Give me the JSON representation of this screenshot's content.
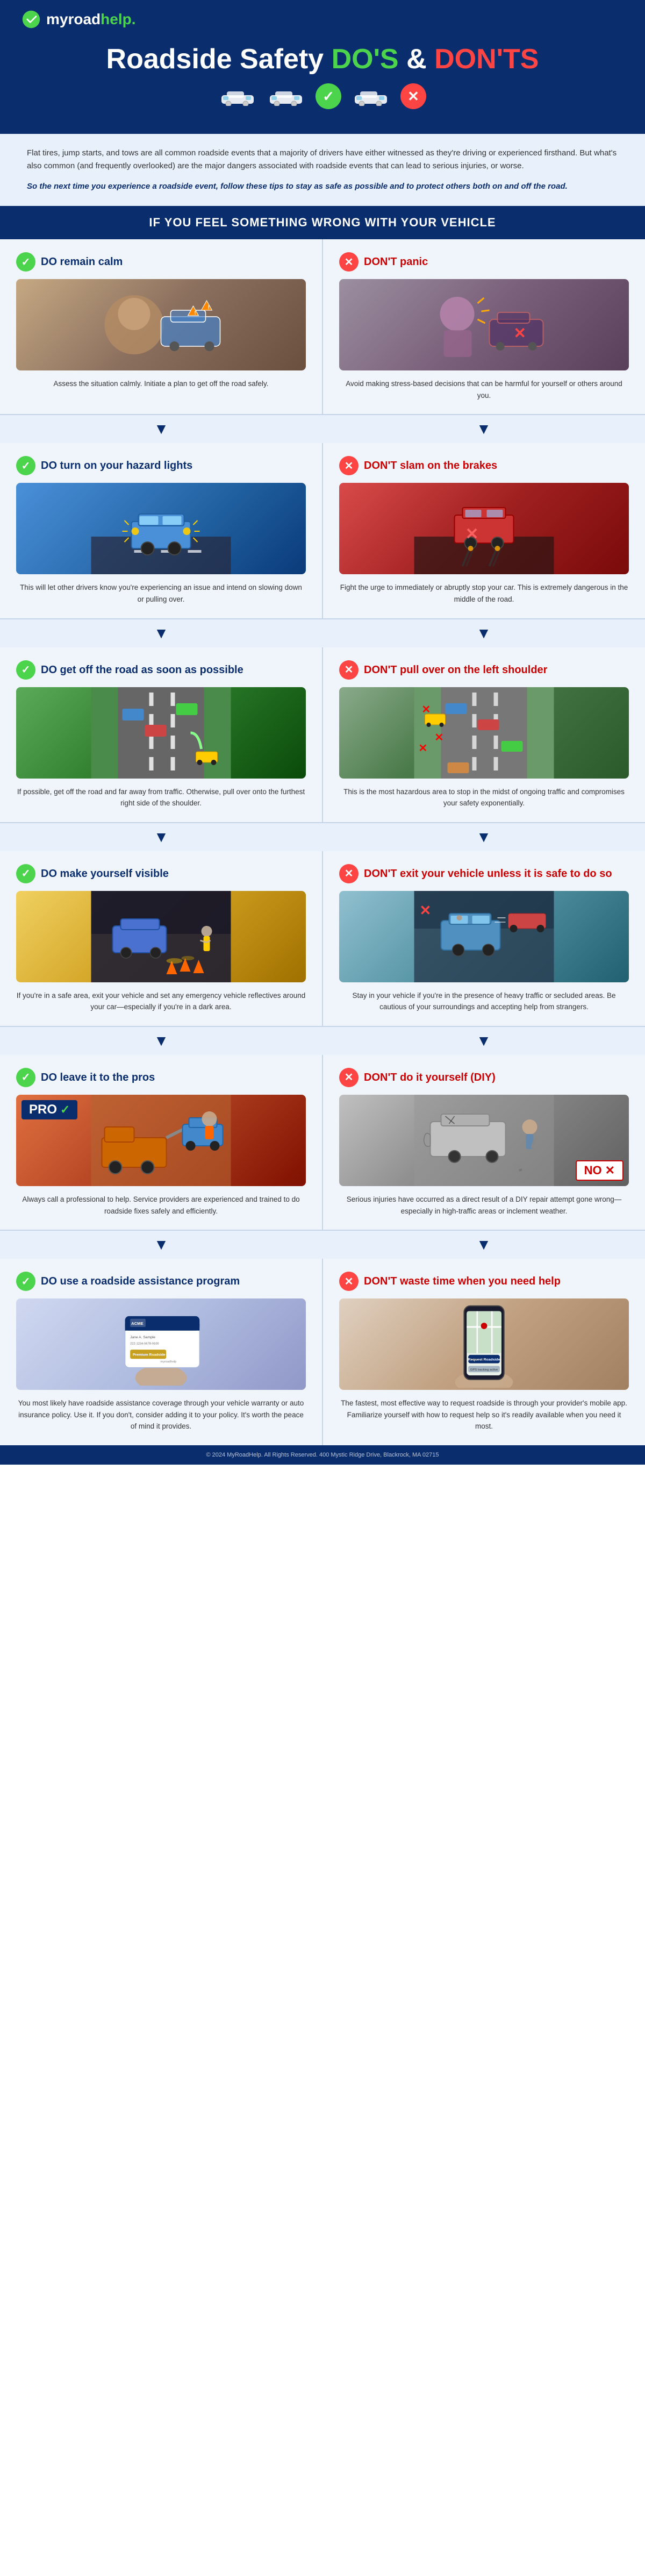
{
  "header": {
    "logo_text": "my",
    "logo_text2": "road",
    "logo_text3": "help.",
    "logo_desc": "myroadhelp logo"
  },
  "title": {
    "line1": "Roadside Safety ",
    "dos": "DO'S",
    "separator": " & ",
    "donts": "DON'TS"
  },
  "intro": {
    "para1": "Flat tires, jump starts, and tows are all common roadside events that a majority of drivers have either witnessed as they're driving or experienced firsthand. But what's also common (and frequently overlooked) are the major dangers associated with roadside events that can lead to serious injuries, or worse.",
    "para2": "So the next time you experience a roadside event, follow these tips to stay as safe as possible and to protect others both on and off the road."
  },
  "section_header": "IF YOU FEEL SOMETHING WRONG WITH YOUR VEHICLE",
  "tips": [
    {
      "do_title": "DO remain calm",
      "dont_title": "DON'T panic",
      "do_desc": "Assess the situation calmly. Initiate a plan to get off the road safely.",
      "dont_desc": "Avoid making stress-based decisions that can be harmful for yourself or others around you."
    },
    {
      "do_title": "DO turn on your hazard lights",
      "dont_title": "DON'T slam on the brakes",
      "do_desc": "This will let other drivers know you're experiencing an issue and intend on slowing down or pulling over.",
      "dont_desc": "Fight the urge to immediately or abruptly stop your car. This is extremely dangerous in the middle of the road."
    },
    {
      "do_title": "DO get off the road as soon as possible",
      "dont_title": "DON'T pull over on the left shoulder",
      "do_desc": "If possible, get off the road and far away from traffic. Otherwise, pull over onto the furthest right side of the shoulder.",
      "dont_desc": "This is the most hazardous area to stop in the midst of ongoing traffic and compromises your safety exponentially."
    },
    {
      "do_title": "DO make yourself visible",
      "dont_title": "DON'T exit your vehicle unless it is safe to do so",
      "do_desc": "If you're in a safe area, exit your vehicle and set any emergency vehicle reflectives around your car—especially if you're in a dark area.",
      "dont_desc": "Stay in your vehicle if you're in the presence of heavy traffic or secluded areas. Be cautious of your surroundings and accepting help from strangers."
    },
    {
      "do_title": "DO leave it to the pros",
      "dont_title": "DON'T do it yourself (DIY)",
      "do_desc": "Always call a professional to help. Service providers are experienced and trained to do roadside fixes safely and efficiently.",
      "dont_desc": "Serious injuries have occurred as a direct result of a DIY repair attempt gone wrong—especially in high-traffic areas or inclement weather."
    },
    {
      "do_title": "DO use a roadside assistance program",
      "dont_title": "DON'T waste time when you need help",
      "do_desc": "You most likely have roadside assistance coverage through your vehicle warranty or auto insurance policy. Use it. If you don't, consider adding it to your policy. It's worth the peace of mind it provides.",
      "dont_desc": "The fastest, most effective way to request roadside is through your provider's mobile app. Familiarize yourself with how to request help so it's readily available when you need it most."
    }
  ],
  "card": {
    "name": "ACME",
    "holder": "Jane A. Sample",
    "phone": "222-1234-5678-9100",
    "label": "Premium Roadside"
  },
  "footer": {
    "text": "© 2024 MyRoadHelp. All Rights Reserved. 400 Mystic Ridge Drive, Blackrock, MA 02715"
  },
  "check_symbol": "✓",
  "x_symbol": "✕",
  "arrow_down": "▼"
}
